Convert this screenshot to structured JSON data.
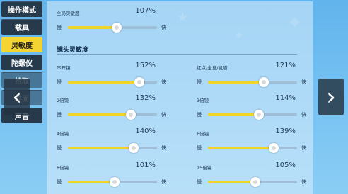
{
  "sidebar": {
    "tabs": [
      {
        "label": "操作模式",
        "state": "normal"
      },
      {
        "label": "载具",
        "state": "normal"
      },
      {
        "label": "灵敏度",
        "state": "active"
      },
      {
        "label": "陀螺仪",
        "state": "normal"
      },
      {
        "label": "拾取",
        "state": "muted"
      },
      {
        "label": "界面",
        "state": "muted"
      },
      {
        "label": "声音",
        "state": "normal"
      }
    ]
  },
  "navigation": {
    "prev_icon": "chevron-left-icon",
    "next_icon": "chevron-right-icon",
    "prev_glyph": "‹",
    "next_glyph": "›"
  },
  "global": {
    "label": "全局灵敏度",
    "value": "107%",
    "level": 0.55,
    "slow": "慢",
    "fast": "快"
  },
  "lens_section": {
    "title": "镜头灵敏度",
    "settings": [
      {
        "label": "不开镜",
        "value": "152%",
        "level": 0.8,
        "slow": "慢",
        "fast": "快"
      },
      {
        "label": "红点/全息/机瞄",
        "value": "121%",
        "level": 0.63,
        "slow": "慢",
        "fast": "快"
      },
      {
        "label": "2倍镜",
        "value": "132%",
        "level": 0.71,
        "slow": "慢",
        "fast": "快"
      },
      {
        "label": "3倍镜",
        "value": "114%",
        "level": 0.57,
        "slow": "慢",
        "fast": "快"
      },
      {
        "label": "4倍镜",
        "value": "140%",
        "level": 0.74,
        "slow": "慢",
        "fast": "快"
      },
      {
        "label": "6倍镜",
        "value": "139%",
        "level": 0.74,
        "slow": "慢",
        "fast": "快"
      },
      {
        "label": "8倍镜",
        "value": "101%",
        "level": 0.52,
        "slow": "慢",
        "fast": "快"
      },
      {
        "label": "15倍镜",
        "value": "105%",
        "level": 0.53,
        "slow": "慢",
        "fast": "快"
      }
    ]
  },
  "colors": {
    "accent": "#f4d431",
    "tab_bg": "#273a4c",
    "track": "#9fbfd8"
  }
}
